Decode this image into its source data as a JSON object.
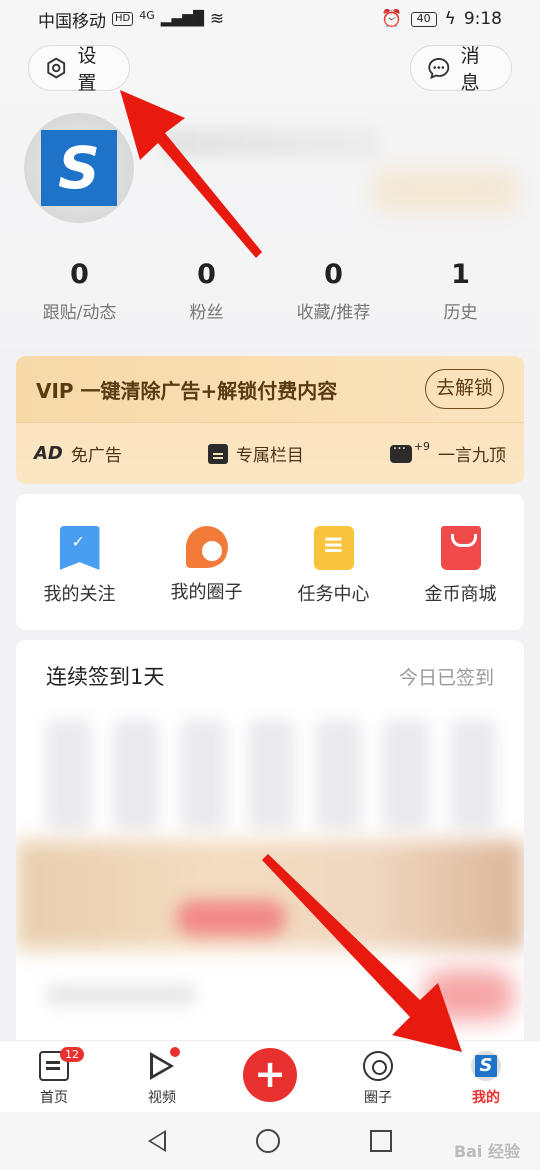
{
  "status_bar": {
    "carrier": "中国移动",
    "hd_badge": "HD",
    "network": "4G",
    "battery": "40",
    "time": "9:18"
  },
  "header": {
    "settings_label": "设置",
    "messages_label": "消息",
    "stats": [
      {
        "value": "0",
        "label": "跟贴/动态"
      },
      {
        "value": "0",
        "label": "粉丝"
      },
      {
        "value": "0",
        "label": "收藏/推荐"
      },
      {
        "value": "1",
        "label": "历史"
      }
    ]
  },
  "vip": {
    "title": "VIP 一键清除广告+解锁付费内容",
    "unlock_label": "去解锁",
    "perks": [
      {
        "mark": "AD",
        "label": "免广告"
      },
      {
        "label": "专属栏目"
      },
      {
        "sup": "+9",
        "label": "一言九顶"
      }
    ]
  },
  "menu": [
    {
      "label": "我的关注",
      "icon": "bookmark-icon"
    },
    {
      "label": "我的圈子",
      "icon": "circle-chat-icon"
    },
    {
      "label": "任务中心",
      "icon": "task-list-icon"
    },
    {
      "label": "金币商城",
      "icon": "shopping-bag-icon"
    }
  ],
  "signin": {
    "title": "连续签到1天",
    "status": "今日已签到"
  },
  "tabs": [
    {
      "label": "首页",
      "badge": "12",
      "icon": "home-icon"
    },
    {
      "label": "视频",
      "icon": "video-icon"
    },
    {
      "label": "",
      "icon": "plus-icon"
    },
    {
      "label": "圈子",
      "icon": "circle-icon"
    },
    {
      "label": "我的",
      "icon": "me-avatar-icon",
      "active": true
    }
  ],
  "colors": {
    "accent": "#e8302e",
    "vip_bg": "#fbe1b6",
    "vip_text": "#5a3a12",
    "arrow": "#e8190f"
  },
  "watermark": "Bai 经验"
}
